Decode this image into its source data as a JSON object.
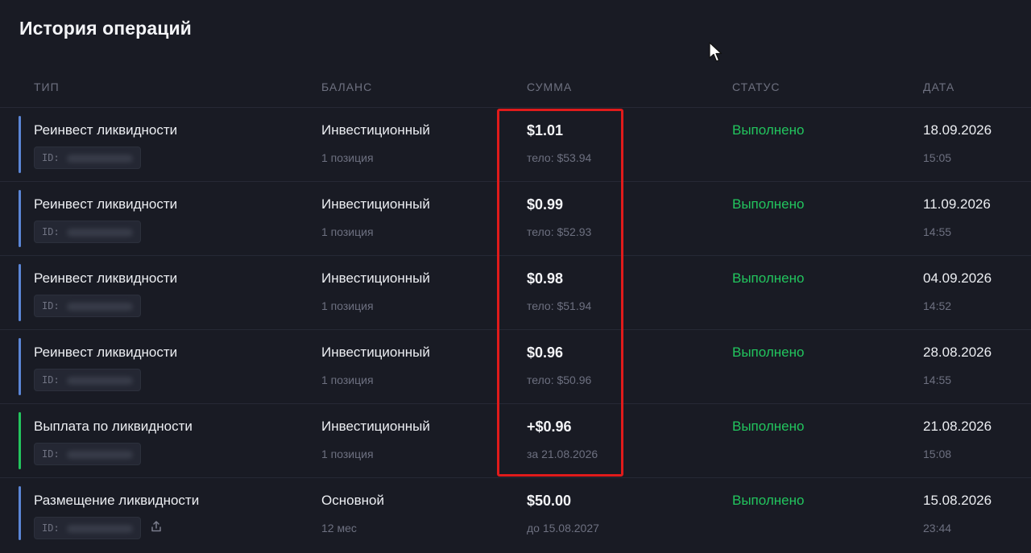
{
  "page": {
    "title": "История операций"
  },
  "columns": {
    "type": "ТИП",
    "balance": "БАЛАНС",
    "amount": "СУММА",
    "status": "СТАТУС",
    "date": "ДАТА"
  },
  "id_label": "ID:",
  "colors": {
    "accent_blue": "#5b86d6",
    "accent_green": "#23c55e",
    "highlight_red": "#e01b1b"
  },
  "rows": [
    {
      "type": "Реинвест ликвидности",
      "balance": "Инвестиционный",
      "balance_sub": "1 позиция",
      "amount": "$1.01",
      "amount_sub": "тело: $53.94",
      "status": "Выполнено",
      "date": "18.09.2026",
      "time": "15:05",
      "bar_color": "blue"
    },
    {
      "type": "Реинвест ликвидности",
      "balance": "Инвестиционный",
      "balance_sub": "1 позиция",
      "amount": "$0.99",
      "amount_sub": "тело: $52.93",
      "status": "Выполнено",
      "date": "11.09.2026",
      "time": "14:55",
      "bar_color": "blue"
    },
    {
      "type": "Реинвест ликвидности",
      "balance": "Инвестиционный",
      "balance_sub": "1 позиция",
      "amount": "$0.98",
      "amount_sub": "тело: $51.94",
      "status": "Выполнено",
      "date": "04.09.2026",
      "time": "14:52",
      "bar_color": "blue"
    },
    {
      "type": "Реинвест ликвидности",
      "balance": "Инвестиционный",
      "balance_sub": "1 позиция",
      "amount": "$0.96",
      "amount_sub": "тело: $50.96",
      "status": "Выполнено",
      "date": "28.08.2026",
      "time": "14:55",
      "bar_color": "blue"
    },
    {
      "type": "Выплата по ликвидности",
      "balance": "Инвестиционный",
      "balance_sub": "1 позиция",
      "amount": "+$0.96",
      "amount_sub": "за 21.08.2026",
      "status": "Выполнено",
      "date": "21.08.2026",
      "time": "15:08",
      "bar_color": "green"
    },
    {
      "type": "Размещение ликвидности",
      "balance": "Основной",
      "balance_sub": "12 мес",
      "amount": "$50.00",
      "amount_sub": "до 15.08.2027",
      "status": "Выполнено",
      "date": "15.08.2026",
      "time": "23:44",
      "bar_color": "blue",
      "share_icon": "share-icon"
    }
  ]
}
